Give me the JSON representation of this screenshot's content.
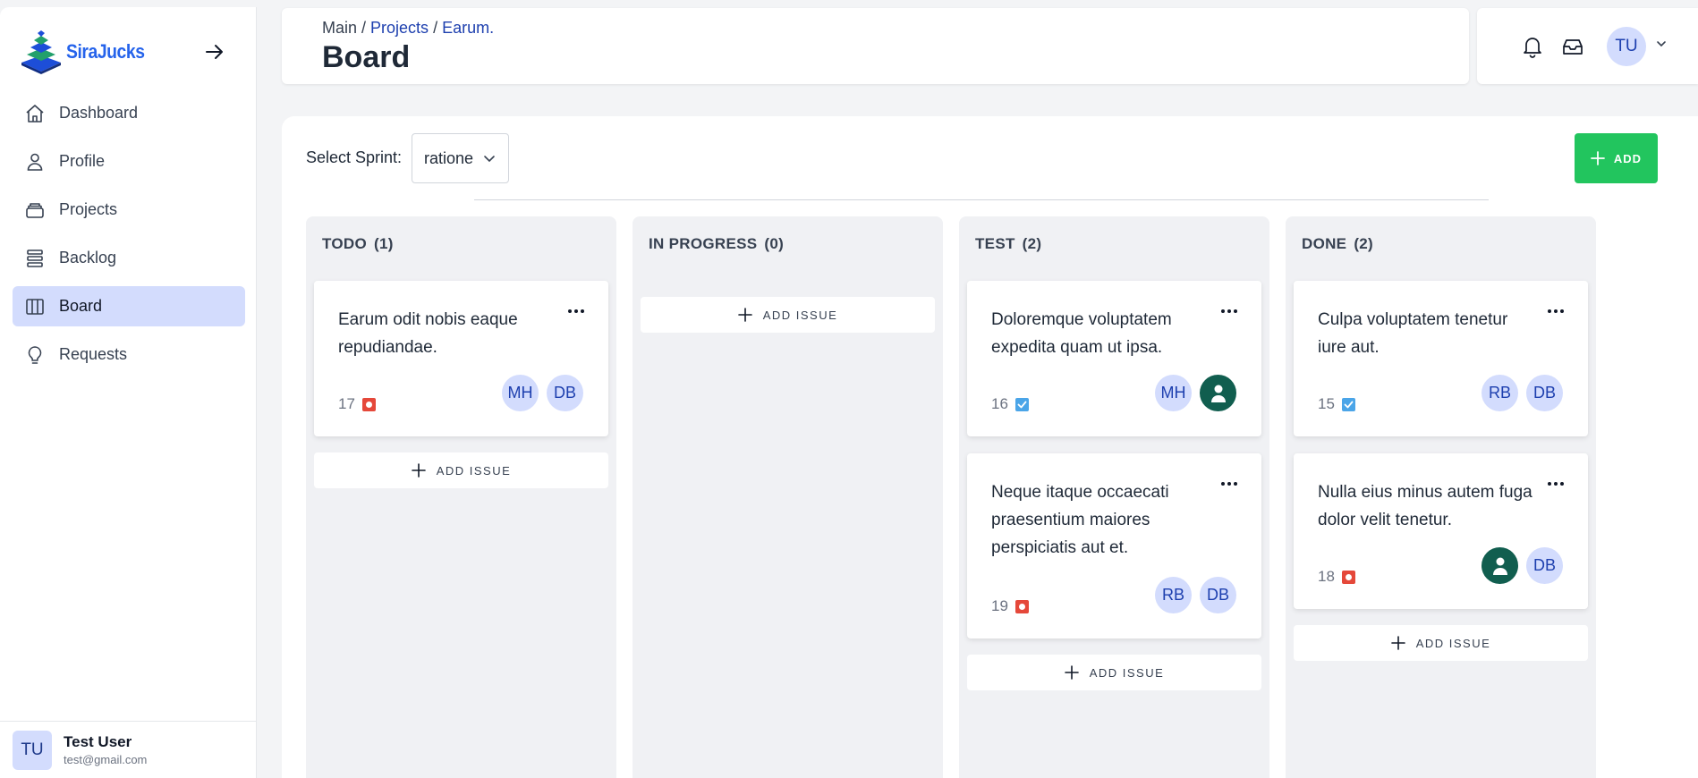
{
  "app": {
    "name": "SiraJucks"
  },
  "sidebar": {
    "items": [
      {
        "label": "Dashboard",
        "icon": "home-icon"
      },
      {
        "label": "Profile",
        "icon": "user-icon"
      },
      {
        "label": "Projects",
        "icon": "folder-icon"
      },
      {
        "label": "Backlog",
        "icon": "stack-icon"
      },
      {
        "label": "Board",
        "icon": "columns-icon",
        "active": true
      },
      {
        "label": "Requests",
        "icon": "lightbulb-icon"
      }
    ],
    "user": {
      "initials": "TU",
      "name": "Test User",
      "email": "test@gmail.com"
    }
  },
  "header": {
    "breadcrumb": {
      "main": "Main",
      "sep1": " / ",
      "projects": "Projects",
      "sep2": " / ",
      "current": "Earum."
    },
    "title": "Board",
    "user_initials": "TU"
  },
  "toolbar": {
    "sprint_label": "Select Sprint:",
    "sprint_value": "ratione",
    "add_label": "ADD"
  },
  "columns": [
    {
      "name": "TODO",
      "count": "(1)",
      "cards": [
        {
          "title": "Earum odit nobis eaque repudiandae.",
          "id": "17",
          "type": "high",
          "assignees": [
            {
              "initials": "MH"
            },
            {
              "initials": "DB"
            }
          ]
        }
      ]
    },
    {
      "name": "IN PROGRESS",
      "count": "(0)",
      "cards": []
    },
    {
      "name": "TEST",
      "count": "(2)",
      "cards": [
        {
          "title": "Doloremque voluptatem expedita quam ut ipsa.",
          "id": "16",
          "type": "task",
          "assignees": [
            {
              "initials": "MH"
            },
            {
              "initials": "",
              "placeholder": true
            }
          ]
        },
        {
          "title": "Neque itaque occaecati praesentium maiores perspiciatis aut et.",
          "id": "19",
          "type": "high",
          "assignees": [
            {
              "initials": "RB"
            },
            {
              "initials": "DB"
            }
          ]
        }
      ]
    },
    {
      "name": "DONE",
      "count": "(2)",
      "cards": [
        {
          "title": "Culpa voluptatem tenetur iure aut.",
          "id": "15",
          "type": "task",
          "assignees": [
            {
              "initials": "RB"
            },
            {
              "initials": "DB"
            }
          ]
        },
        {
          "title": "Nulla eius minus autem fuga dolor velit tenetur.",
          "id": "18",
          "type": "high",
          "assignees": [
            {
              "initials": "",
              "placeholder": true
            },
            {
              "initials": "DB"
            }
          ]
        }
      ]
    }
  ],
  "add_issue_label": "ADD ISSUE",
  "colors": {
    "accent": "#d3dcfd",
    "add_button": "#22c55e",
    "priority_high": "#e5483a",
    "task": "#4ba5e8",
    "placeholder_avatar": "#115e4f"
  }
}
